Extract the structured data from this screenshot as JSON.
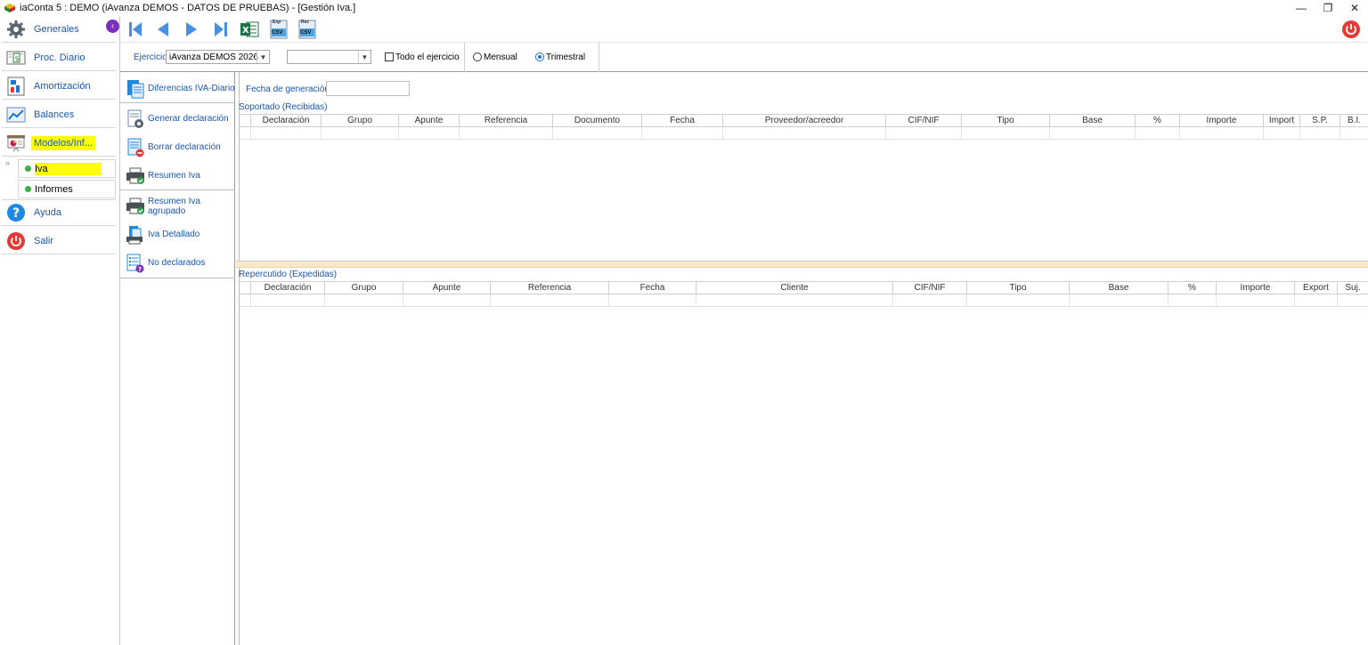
{
  "window": {
    "title": "iaConta 5 : DEMO (iAvanza DEMOS - DATOS DE PRUEBAS) - [Gestión Iva.]",
    "minimize_glyph": "—",
    "restore_glyph": "❐",
    "close_glyph": "✕"
  },
  "sidebar": {
    "collapse_glyph": "‹",
    "items": [
      {
        "label": "Generales",
        "icon": "gear-icon"
      },
      {
        "label": "Proc. Diario",
        "icon": "journal-icon"
      },
      {
        "label": "Amortización",
        "icon": "depreciation-icon"
      },
      {
        "label": "Balances",
        "icon": "chart-icon"
      },
      {
        "label": "Modelos/Inf...",
        "icon": "presentation-icon",
        "highlighted": true
      },
      {
        "label": "Ayuda",
        "icon": "help-icon"
      },
      {
        "label": "Salir",
        "icon": "power-icon"
      }
    ],
    "expand_glyph": "»",
    "subitems": [
      {
        "label": "Iva",
        "highlighted": true
      },
      {
        "label": "Informes"
      }
    ]
  },
  "toolbar": {
    "buttons": [
      "first-icon",
      "previous-icon",
      "next-icon",
      "last-icon",
      "excel-icon",
      "export-csv-icon",
      "import-csv-icon",
      "power-icon"
    ],
    "exp_label": "Exp",
    "rec_label": "Rec",
    "csv_label": "CSV"
  },
  "filters": {
    "ejercicio_label": "Ejercicio",
    "ejercicio_value": "iAvanza DEMOS 2026",
    "period_value": "",
    "todo_label": "Todo el ejercicio",
    "todo_checked": false,
    "mensual_label": "Mensual",
    "trimestral_label": "Trimestral",
    "selected_period_type": "Trimestral"
  },
  "actions": [
    {
      "label": "Diferencias IVA-Diario",
      "icon": "differences-icon"
    },
    {
      "label": "Generar declaración",
      "icon": "generate-declaration-icon"
    },
    {
      "label": "Borrar declaración",
      "icon": "delete-declaration-icon"
    },
    {
      "label": "Resumen Iva",
      "icon": "printer-icon"
    },
    {
      "label": "Resumen Iva agrupado",
      "icon": "printer-grouped-icon"
    },
    {
      "label": "Iva Detallado",
      "icon": "detailed-print-icon"
    },
    {
      "label": "No declarados",
      "icon": "undeclared-list-icon"
    }
  ],
  "main": {
    "fecha_label": "Fecha de generación",
    "fecha_value": "",
    "soportado": {
      "title": "Soportado  (Recibidas)",
      "columns": [
        "Declaración",
        "Grupo",
        "Apunte",
        "Referencia",
        "Documento",
        "Fecha",
        "Proveedor/acreedor",
        "CIF/NIF",
        "Tipo",
        "Base",
        "%",
        "Importe",
        "Import",
        "S.P.",
        "B.I."
      ]
    },
    "repercutido": {
      "title": "Repercutido  (Expedidas)",
      "columns": [
        "Declaración",
        "Grupo",
        "Apunte",
        "Referencia",
        "Fecha",
        "Cliente",
        "CIF/NIF",
        "Tipo",
        "Base",
        "%",
        "Importe",
        "Export",
        "Suj."
      ]
    }
  },
  "colors": {
    "accent_blue": "#1a56b0",
    "highlight_yellow": "#ffff00",
    "collapse_purple": "#7b2fbe",
    "power_red": "#e53935",
    "status_green": "#3cb043",
    "splitter": "#fbe8c4"
  }
}
